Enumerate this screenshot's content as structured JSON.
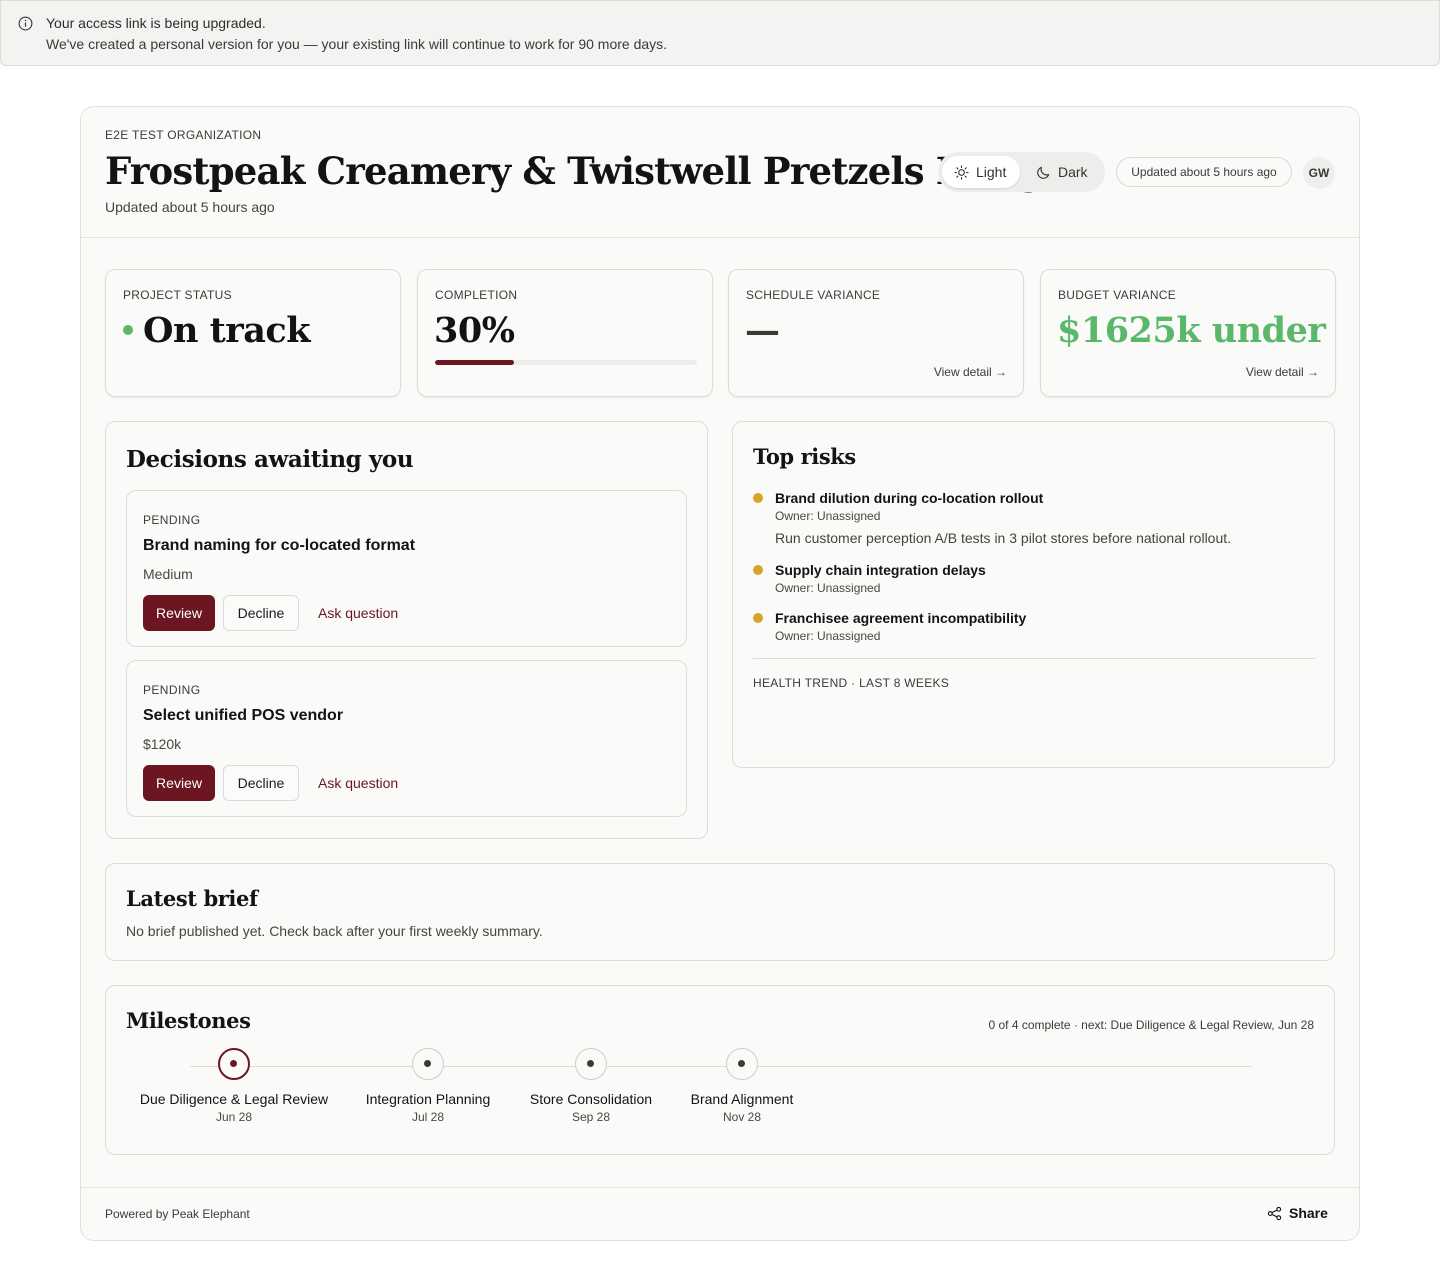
{
  "banner": {
    "title": "Your access link is being upgraded.",
    "body": "We've created a personal version for you — your existing link will continue to work for 90 more days."
  },
  "header": {
    "organization": "E2E TEST ORGANIZATION",
    "title": "Frostpeak Creamery & Twistwell Pretzels Merger",
    "subtitle": "Updated about 5 hours ago",
    "theme_light": "Light",
    "theme_dark": "Dark",
    "updated_pill": "Updated about 5 hours ago",
    "avatar_initials": "GW"
  },
  "kpis": {
    "status": {
      "label": "PROJECT STATUS",
      "value": "On track",
      "dot_color": "#5bb86a"
    },
    "completion": {
      "label": "COMPLETION",
      "value": "30%",
      "progress": 0.3
    },
    "schedule": {
      "label": "SCHEDULE VARIANCE",
      "value": "—",
      "link": "View detail →"
    },
    "budget": {
      "label": "BUDGET VARIANCE",
      "value": "$1625k under",
      "value_color": "#5bb86a",
      "link": "View detail →"
    }
  },
  "decisions": {
    "title": "Decisions awaiting you",
    "items": [
      {
        "status": "PENDING",
        "title": "Brand naming for co-located format",
        "meta": "Medium",
        "review": "Review",
        "decline": "Decline",
        "ask": "Ask question"
      },
      {
        "status": "PENDING",
        "title": "Select unified POS vendor",
        "meta": "$120k",
        "review": "Review",
        "decline": "Decline",
        "ask": "Ask question"
      }
    ]
  },
  "risks": {
    "title": "Top risks",
    "items": [
      {
        "title": "Brand dilution during co-location rollout",
        "owner": "Owner: Unassigned",
        "mitigation": "Run customer perception A/B tests in 3 pilot stores before national rollout."
      },
      {
        "title": "Supply chain integration delays",
        "owner": "Owner: Unassigned"
      },
      {
        "title": "Franchisee agreement incompatibility",
        "owner": "Owner: Unassigned"
      }
    ],
    "health_trend_label": "HEALTH TREND · LAST 8 WEEKS"
  },
  "brief": {
    "title": "Latest brief",
    "body": "No brief published yet. Check back after your first weekly summary."
  },
  "milestones": {
    "title": "Milestones",
    "summary": "0 of 4 complete · next: Due Diligence & Legal Review, Jun 28",
    "items": [
      {
        "name": "Due Diligence & Legal Review",
        "date": "Jun 28",
        "current": true
      },
      {
        "name": "Integration Planning",
        "date": "Jul 28",
        "current": false
      },
      {
        "name": "Store Consolidation",
        "date": "Sep 28",
        "current": false
      },
      {
        "name": "Brand Alignment",
        "date": "Nov 28",
        "current": false
      }
    ]
  },
  "footer": {
    "powered_by": "Powered by Peak Elephant",
    "share": "Share"
  },
  "colors": {
    "accent": "#6b1620",
    "success": "#5bb86a",
    "warning": "#d9a528"
  }
}
